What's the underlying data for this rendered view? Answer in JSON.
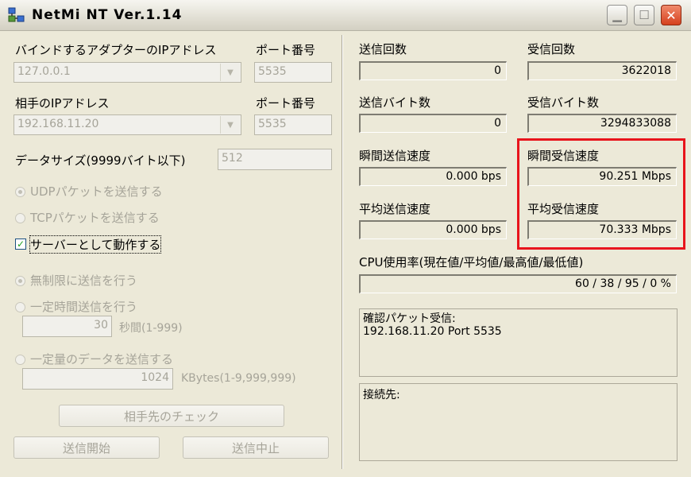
{
  "window": {
    "title": "NetMi NT Ver.1.14"
  },
  "left": {
    "bind_ip_label": "バインドするアダプターのIPアドレス",
    "port_label_1": "ポート番号",
    "bind_ip_value": "127.0.0.1",
    "port_value_1": "5535",
    "remote_ip_label": "相手のIPアドレス",
    "port_label_2": "ポート番号",
    "remote_ip_value": "192.168.11.20",
    "port_value_2": "5535",
    "datasize_label": "データサイズ(9999バイト以下)",
    "datasize_value": "512",
    "udp_label": "UDPパケットを送信する",
    "tcp_label": "TCPパケットを送信する",
    "server_label": "サーバーとして動作する",
    "unlimited_label": "無制限に送信を行う",
    "timed_label": "一定時間送信を行う",
    "timed_value": "30",
    "timed_unit": "秒間(1-999)",
    "amount_label": "一定量のデータを送信する",
    "amount_value": "1024",
    "amount_unit": "KBytes(1-9,999,999)",
    "check_button": "相手先のチェック",
    "start_button": "送信開始",
    "stop_button": "送信中止"
  },
  "right": {
    "send_count_label": "送信回数",
    "send_count": "0",
    "recv_count_label": "受信回数",
    "recv_count": "3622018",
    "send_bytes_label": "送信バイト数",
    "send_bytes": "0",
    "recv_bytes_label": "受信バイト数",
    "recv_bytes": "3294833088",
    "inst_send_label": "瞬間送信速度",
    "inst_send": "0.000 bps",
    "inst_recv_label": "瞬間受信速度",
    "inst_recv": "90.251  Mbps",
    "avg_send_label": "平均送信速度",
    "avg_send": "0.000 bps",
    "avg_recv_label": "平均受信速度",
    "avg_recv": "70.333  Mbps",
    "cpu_label": "CPU使用率(現在値/平均値/最高値/最低値)",
    "cpu_value": "60  /  38  /  95  /   0 %",
    "confirm_text": "確認パケット受信:\n192.168.11.20 Port 5535",
    "connect_text": "接続先:"
  },
  "colors": {
    "highlight": "#e8141c",
    "face": "#ece9d8"
  }
}
